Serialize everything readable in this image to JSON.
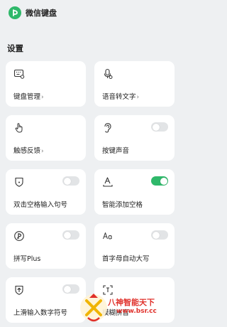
{
  "header": {
    "app_name": "微信键盘",
    "logo_icon": "wechat-keyboard-logo-icon"
  },
  "section_title": "设置",
  "colors": {
    "accent": "#2fb86a",
    "toggle_off": "#e2e4e6",
    "background": "#eef0f2"
  },
  "cards": [
    {
      "label": "键盘管理",
      "arrow": "›",
      "icon": "keyboard-settings-icon"
    },
    {
      "label": "语音转文字",
      "arrow": "›",
      "icon": "microphone-icon"
    },
    {
      "label": "触感反馈",
      "arrow": "›",
      "icon": "touch-hand-icon"
    },
    {
      "label": "按键声音",
      "icon": "ear-icon",
      "toggle": false
    },
    {
      "label": "双击空格输入句号",
      "icon": "period-shield-icon",
      "toggle": false
    },
    {
      "label": "智能添加空格",
      "icon": "text-space-icon",
      "toggle": true
    },
    {
      "label": "拼写Plus",
      "icon": "spell-plus-icon",
      "toggle": false
    },
    {
      "label": "首字母自动大写",
      "icon": "capitalize-aa-icon",
      "toggle": false
    },
    {
      "label": "上滑输入数字符号",
      "icon": "swipe-up-number-icon",
      "toggle": false
    },
    {
      "label": "模糊拼音",
      "icon": "fuzzy-pinyin-icon"
    }
  ],
  "watermark": {
    "line1": "八神智能天下",
    "line2": "www.bsr.cc",
    "icon": "watermark-logo-icon"
  }
}
